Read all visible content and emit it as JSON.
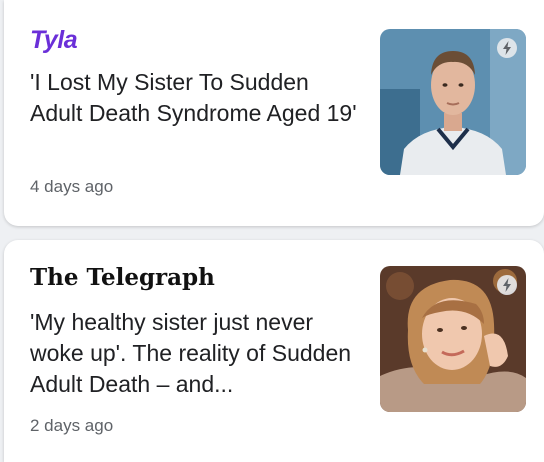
{
  "articles": [
    {
      "publisher": "Tyla",
      "headline": "'I Lost My Sister To Sudden Adult Death Syndrome Aged 19'",
      "time": "4 days ago"
    },
    {
      "publisher": "The Telegraph",
      "headline": "'My healthy sister just never woke up'. The reality of Sudden Adult Death – and...",
      "time": "2 days ago"
    }
  ],
  "icons": {
    "amp": "amp-lightning-icon"
  },
  "colors": {
    "tyla_brand": "#6a2fd8",
    "headline_text": "#202124",
    "timestamp_text": "#5f6368"
  }
}
